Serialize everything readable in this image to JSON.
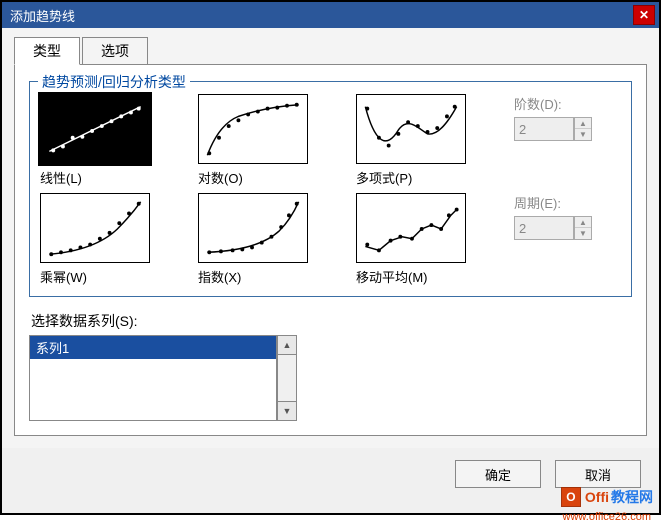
{
  "title": "添加趋势线",
  "tabs": {
    "type": "类型",
    "options": "选项"
  },
  "group": {
    "legend": "趋势预测/回归分析类型",
    "items": {
      "linear": "线性(L)",
      "log": "对数(O)",
      "poly": "多项式(P)",
      "power": "乘幂(W)",
      "exp": "指数(X)",
      "ma": "移动平均(M)"
    },
    "order_label": "阶数(D):",
    "order_value": "2",
    "period_label": "周期(E):",
    "period_value": "2"
  },
  "series": {
    "label": "选择数据系列(S):",
    "item": "系列1"
  },
  "buttons": {
    "ok": "确定",
    "cancel": "取消"
  },
  "watermark": {
    "brand1": "Offi",
    "brand2": "教程网",
    "url": "www.office26.com"
  },
  "chart_data": [
    {
      "type": "scatter",
      "name": "linear",
      "x": [
        1,
        2,
        3,
        4,
        5,
        6,
        7,
        8,
        9,
        10
      ],
      "y": [
        1.2,
        1.6,
        2.8,
        2.9,
        3.6,
        4.2,
        4.9,
        5.4,
        5.9,
        6.4
      ],
      "fit": "line"
    },
    {
      "type": "scatter",
      "name": "log",
      "x": [
        1,
        2,
        3,
        4,
        5,
        6,
        7,
        8,
        9,
        10
      ],
      "y": [
        0.6,
        2.0,
        3.2,
        3.8,
        4.4,
        4.8,
        5.1,
        5.2,
        5.4,
        5.5
      ],
      "fit": "log"
    },
    {
      "type": "scatter",
      "name": "poly",
      "x": [
        1,
        2,
        3,
        4,
        5,
        6,
        7,
        8,
        9,
        10
      ],
      "y": [
        5.0,
        2.5,
        1.4,
        2.4,
        3.6,
        3.4,
        2.8,
        3.4,
        4.6,
        5.6
      ],
      "fit": "poly"
    },
    {
      "type": "scatter",
      "name": "power",
      "x": [
        1,
        2,
        3,
        4,
        5,
        6,
        7,
        8,
        9,
        10
      ],
      "y": [
        0.4,
        0.6,
        0.7,
        1.0,
        1.2,
        1.8,
        2.4,
        3.4,
        4.6,
        6.0
      ],
      "fit": "power"
    },
    {
      "type": "scatter",
      "name": "exp",
      "x": [
        1,
        2,
        3,
        4,
        5,
        6,
        7,
        8,
        9,
        10
      ],
      "y": [
        0.6,
        0.7,
        0.8,
        0.9,
        1.0,
        1.3,
        1.8,
        2.6,
        4.0,
        6.2
      ],
      "fit": "exp"
    },
    {
      "type": "scatter",
      "name": "ma",
      "x": [
        1,
        2,
        3,
        4,
        5,
        6,
        7,
        8,
        9,
        10
      ],
      "y": [
        1.4,
        1.0,
        1.8,
        2.2,
        2.0,
        3.0,
        3.4,
        3.0,
        4.4,
        5.0
      ],
      "fit": "ma"
    }
  ]
}
